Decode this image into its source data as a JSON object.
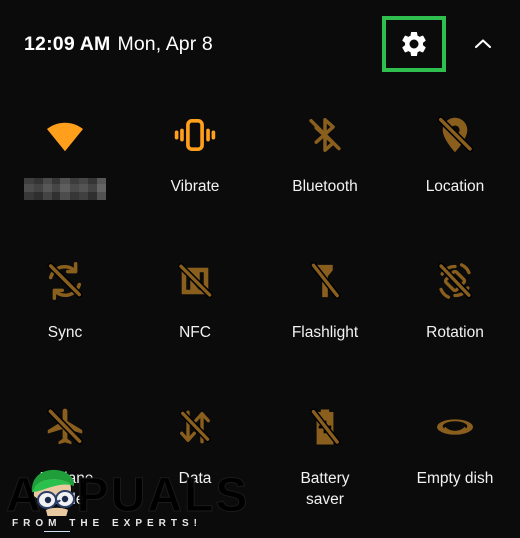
{
  "panel": {
    "name": "android-quick-settings-panel",
    "background_color": "#0b0b0b",
    "accent_active_color": "#ff9f1c",
    "accent_disabled_color": "#8a5f1e",
    "highlight_color": "#2fbf4f",
    "label_color": "#f2f2f2"
  },
  "header": {
    "time": "12:09 AM",
    "date": "Mon, Apr 8",
    "settings_icon": "gear-icon",
    "settings_highlighted": true,
    "collapse_icon": "chevron-up-icon"
  },
  "tiles": [
    {
      "id": "wifi",
      "label": "",
      "label_censored": true,
      "icon": "wifi-icon",
      "state": "on"
    },
    {
      "id": "vibrate",
      "label": "Vibrate",
      "label_censored": false,
      "icon": "vibrate-icon",
      "state": "on"
    },
    {
      "id": "bluetooth",
      "label": "Bluetooth",
      "label_censored": false,
      "icon": "bluetooth-off-icon",
      "state": "off"
    },
    {
      "id": "location",
      "label": "Location",
      "label_censored": false,
      "icon": "location-off-icon",
      "state": "off"
    },
    {
      "id": "sync",
      "label": "Sync",
      "label_censored": false,
      "icon": "sync-off-icon",
      "state": "off"
    },
    {
      "id": "nfc",
      "label": "NFC",
      "label_censored": false,
      "icon": "nfc-off-icon",
      "state": "off"
    },
    {
      "id": "flashlight",
      "label": "Flashlight",
      "label_censored": false,
      "icon": "flashlight-off-icon",
      "state": "off"
    },
    {
      "id": "rotation",
      "label": "Rotation",
      "label_censored": false,
      "icon": "rotation-off-icon",
      "state": "off"
    },
    {
      "id": "airplane-mode",
      "label": "Airplane\nmode",
      "label_censored": false,
      "icon": "airplane-off-icon",
      "state": "off"
    },
    {
      "id": "data",
      "label": "Data",
      "label_censored": false,
      "icon": "mobile-data-off-icon",
      "state": "off"
    },
    {
      "id": "battery-saver",
      "label": "Battery\nsaver",
      "label_censored": false,
      "icon": "battery-saver-off-icon",
      "state": "off"
    },
    {
      "id": "empty-dish",
      "label": "Empty dish",
      "label_censored": false,
      "icon": "dish-icon",
      "state": "off"
    }
  ],
  "watermark": {
    "brand": "APPUALS",
    "tagline": "FROM THE EXPERTS!",
    "mascot": "cartoon-mascot-icon"
  }
}
